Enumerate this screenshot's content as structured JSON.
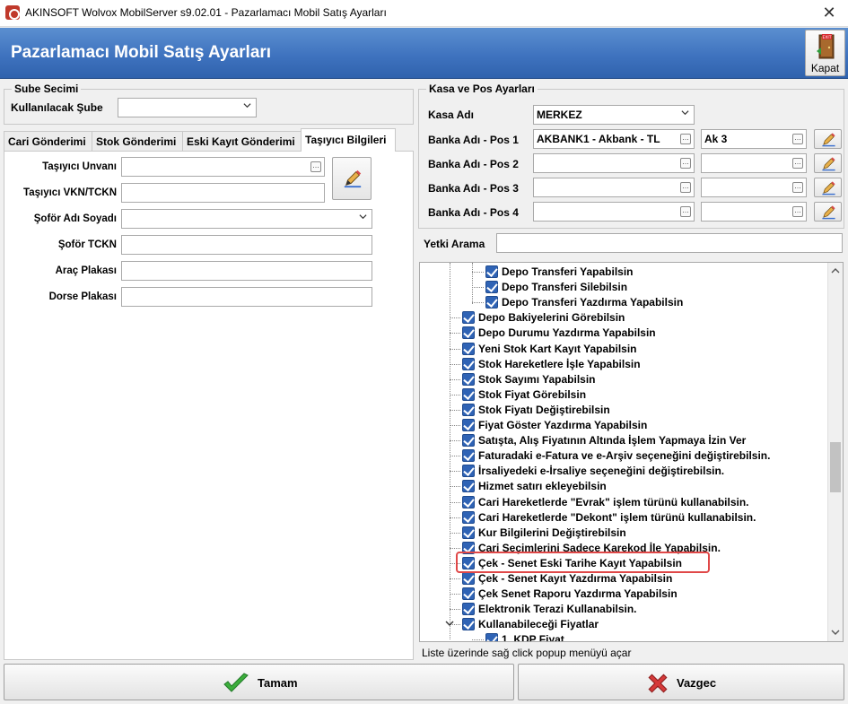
{
  "window": {
    "title": "AKINSOFT Wolvox MobilServer s9.02.01 - Pazarlamacı Mobil Satış Ayarları",
    "close_glyph": "✕"
  },
  "header": {
    "title": "Pazarlamacı Mobil Satış Ayarları",
    "close_label": "Kapat",
    "close_icon": "exit-door-icon"
  },
  "branch": {
    "group_title": "Sube Secimi",
    "label": "Kullanılacak Şube",
    "value": ""
  },
  "tabs": [
    {
      "label": "Cari Gönderimi"
    },
    {
      "label": "Stok Gönderimi"
    },
    {
      "label": "Eski Kayıt Gönderimi"
    },
    {
      "label": "Taşıyıcı Bilgileri"
    }
  ],
  "active_tab": 3,
  "carrier": {
    "fields": [
      {
        "label": "Taşıyıcı Unvanı",
        "value": ""
      },
      {
        "label": "Taşıyıcı VKN/TCKN",
        "value": ""
      },
      {
        "label": "Şoför Adı Soyadı",
        "value": ""
      },
      {
        "label": "Şoför TCKN",
        "value": ""
      },
      {
        "label": "Araç Plakası",
        "value": ""
      },
      {
        "label": "Dorse Plakası",
        "value": ""
      }
    ]
  },
  "pos": {
    "group_title": "Kasa ve Pos Ayarları",
    "cash_label": "Kasa Adı",
    "cash_value": "MERKEZ",
    "banks": [
      {
        "label": "Banka Adı - Pos 1",
        "bank": "AKBANK1 - Akbank - TL",
        "account": "Ak 3"
      },
      {
        "label": "Banka Adı - Pos 2",
        "bank": "",
        "account": ""
      },
      {
        "label": "Banka Adı - Pos 3",
        "bank": "",
        "account": ""
      },
      {
        "label": "Banka Adı - Pos 4",
        "bank": "",
        "account": ""
      }
    ],
    "auth_search_label": "Yetki Arama",
    "auth_search_value": ""
  },
  "tree": {
    "items": [
      {
        "label": "Depo Transferi Yapabilsin",
        "checked": true,
        "level": 2
      },
      {
        "label": "Depo Transferi Silebilsin",
        "checked": true,
        "level": 2
      },
      {
        "label": "Depo Transferi Yazdırma Yapabilsin",
        "checked": true,
        "level": 2
      },
      {
        "label": "Depo Bakiyelerini Görebilsin",
        "checked": true,
        "level": 1
      },
      {
        "label": "Depo Durumu Yazdırma Yapabilsin",
        "checked": true,
        "level": 1
      },
      {
        "label": "Yeni Stok Kart Kayıt Yapabilsin",
        "checked": true,
        "level": 1
      },
      {
        "label": "Stok Hareketlere İşle Yapabilsin",
        "checked": true,
        "level": 1
      },
      {
        "label": "Stok Sayımı Yapabilsin",
        "checked": true,
        "level": 1
      },
      {
        "label": "Stok Fiyat Görebilsin",
        "checked": true,
        "level": 1
      },
      {
        "label": "Stok Fiyatı Değiştirebilsin",
        "checked": true,
        "level": 1
      },
      {
        "label": "Fiyat Göster Yazdırma Yapabilsin",
        "checked": true,
        "level": 1
      },
      {
        "label": "Satışta, Alış Fiyatının Altında İşlem Yapmaya İzin Ver",
        "checked": true,
        "level": 1
      },
      {
        "label": "Faturadaki e-Fatura ve e-Arşiv  seçeneğini değiştirebilsin.",
        "checked": true,
        "level": 1
      },
      {
        "label": "İrsaliyedeki e-İrsaliye seçeneğini değiştirebilsin.",
        "checked": true,
        "level": 1
      },
      {
        "label": "Hizmet satırı ekleyebilsin",
        "checked": true,
        "level": 1
      },
      {
        "label": "Cari Hareketlerde \"Evrak\" işlem türünü kullanabilsin.",
        "checked": true,
        "level": 1
      },
      {
        "label": "Cari Hareketlerde \"Dekont\" işlem türünü kullanabilsin.",
        "checked": true,
        "level": 1
      },
      {
        "label": "Kur Bilgilerini Değiştirebilsin",
        "checked": true,
        "level": 1
      },
      {
        "label": "Cari Seçimlerini Sadece Karekod İle Yapabilsin.",
        "checked": true,
        "level": 1
      },
      {
        "label": "Çek - Senet Eski Tarihe Kayıt Yapabilsin",
        "checked": true,
        "level": 1,
        "highlighted": true
      },
      {
        "label": "Çek - Senet Kayıt Yazdırma Yapabilsin",
        "checked": true,
        "level": 1
      },
      {
        "label": "Çek Senet Raporu Yazdırma Yapabilsin",
        "checked": true,
        "level": 1
      },
      {
        "label": "Elektronik Terazi Kullanabilsin.",
        "checked": true,
        "level": 1
      },
      {
        "label": "Kullanabileceği Fiyatlar",
        "checked": true,
        "level": 1,
        "expanded": true
      },
      {
        "label": "1. KDP Fiyat",
        "checked": true,
        "level": 2
      }
    ],
    "scroll_position": 0.55
  },
  "hint": "Liste üzerinde sağ click popup menüyü açar",
  "buttons": {
    "ok": "Tamam",
    "cancel": "Vazgec"
  },
  "colors": {
    "header_blue": "#3f73bf",
    "checkbox_blue": "#2f63b5",
    "highlight_red": "#e04848",
    "ok_green": "#3cae3c",
    "cancel_red": "#d63a3a"
  }
}
